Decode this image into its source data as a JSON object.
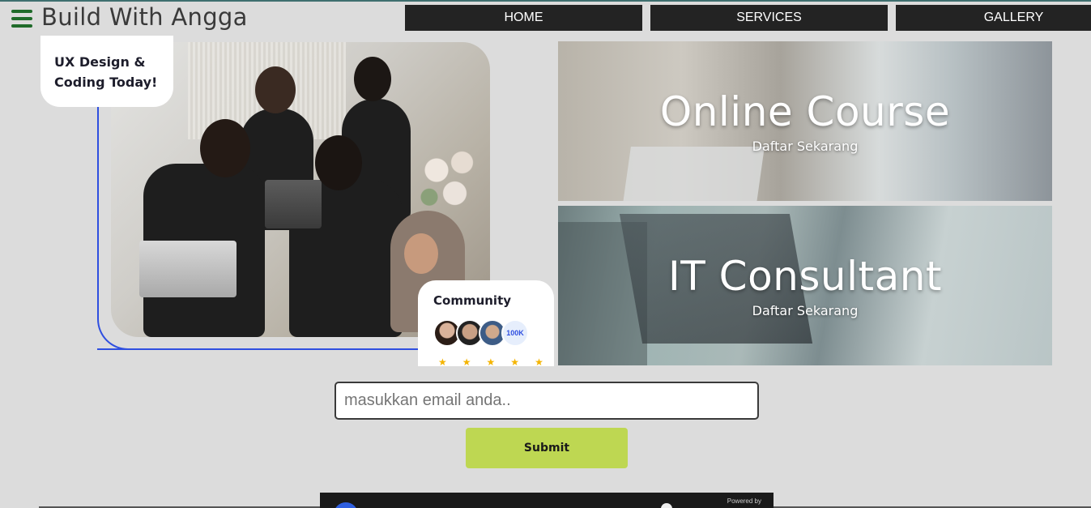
{
  "header": {
    "brand": "Build With Angga",
    "menu_icon": "hamburger-menu-icon",
    "nav": [
      "HOME",
      "SERVICES",
      "GALLERY"
    ]
  },
  "hero": {
    "tagline_line1": "UX Design &",
    "tagline_line2": "Coding Today!",
    "community": {
      "title": "Community",
      "count_badge": "100K",
      "rating_stars": 5
    }
  },
  "panels": [
    {
      "title": "Online Course",
      "subtitle": "Daftar Sekarang"
    },
    {
      "title": "IT Consultant",
      "subtitle": "Daftar Sekarang"
    }
  ],
  "form": {
    "email_placeholder": "masukkan email anda..",
    "email_value": "",
    "submit_label": "Submit"
  },
  "video": {
    "powered_by": "Powered by"
  },
  "colors": {
    "background": "#dcdcdc",
    "nav_bg": "#232323",
    "accent_green": "#bed752",
    "menu_icon": "#1f6b2a",
    "outline_blue": "#2f4fe0"
  }
}
